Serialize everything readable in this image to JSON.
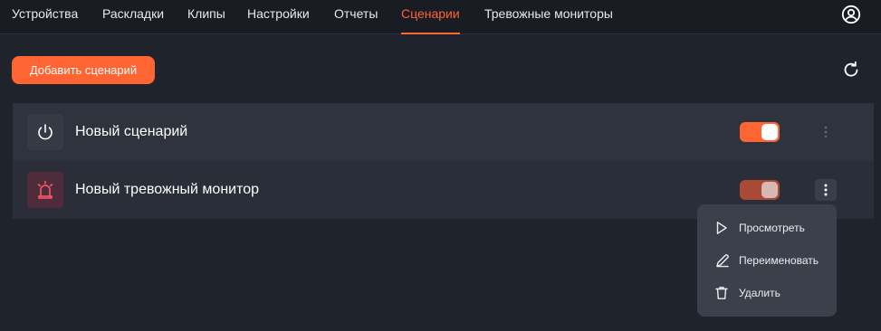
{
  "nav": {
    "tabs": [
      {
        "label": "Устройства",
        "active": false
      },
      {
        "label": "Раскладки",
        "active": false
      },
      {
        "label": "Клипы",
        "active": false
      },
      {
        "label": "Настройки",
        "active": false
      },
      {
        "label": "Отчеты",
        "active": false
      },
      {
        "label": "Сценарии",
        "active": true
      },
      {
        "label": "Тревожные мониторы",
        "active": false
      }
    ],
    "user_icon": "user-circle-icon"
  },
  "toolbar": {
    "add_label": "Добавить сценарий",
    "refresh_icon": "refresh-icon"
  },
  "scenarios": [
    {
      "title": "Новый сценарий",
      "icon": "power-icon",
      "enabled": true,
      "state": "on"
    },
    {
      "title": "Новый тревожный монитор",
      "icon": "alarm-siren-icon",
      "enabled": true,
      "state": "on-dimmed"
    }
  ],
  "context_menu": {
    "items": [
      {
        "label": "Просмотреть",
        "icon": "play-icon"
      },
      {
        "label": "Переименовать",
        "icon": "pencil-icon"
      },
      {
        "label": "Удалить",
        "icon": "trash-icon"
      }
    ]
  },
  "colors": {
    "accent": "#ff6433",
    "background": "#1f232c",
    "topbar": "#191c23",
    "row": "#2f333d",
    "menu": "#3c404b"
  }
}
